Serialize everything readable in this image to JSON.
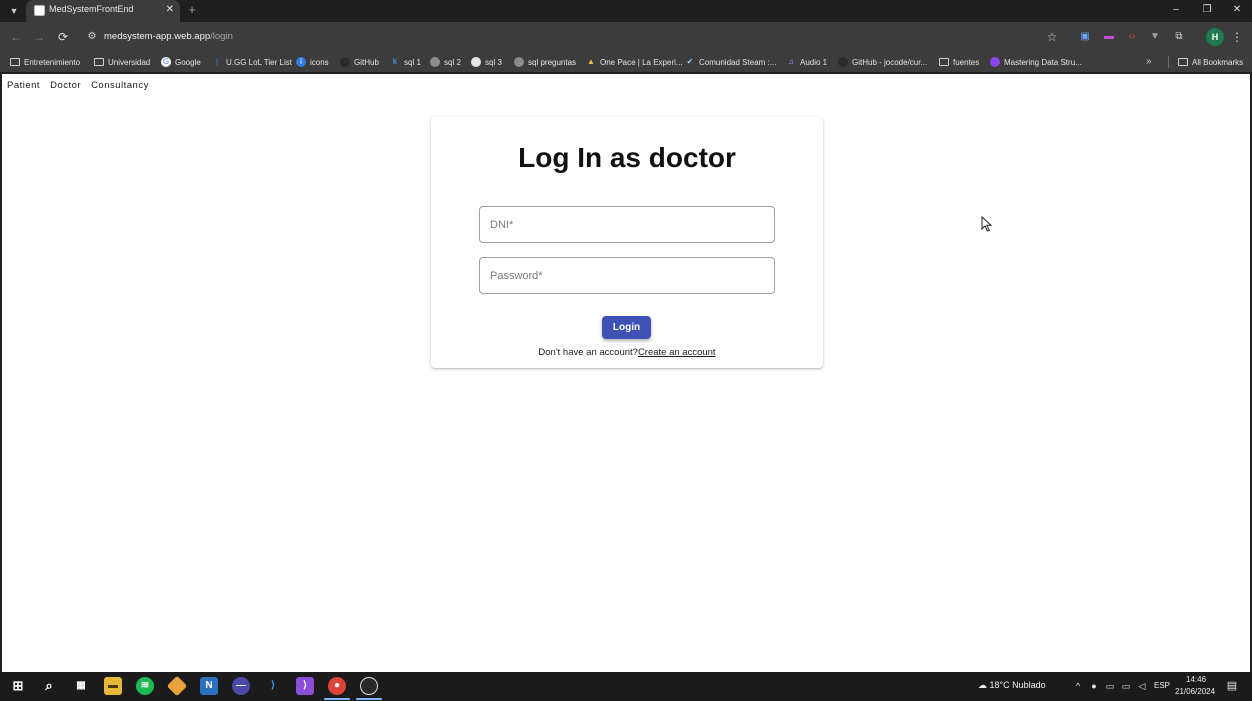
{
  "browser": {
    "tab": {
      "title": "MedSystemFrontEnd",
      "close_glyph": "✕",
      "new_tab_glyph": "+"
    },
    "window_controls": {
      "minimize": "–",
      "restore": "❐",
      "close": "✕"
    },
    "toolbar": {
      "back": "←",
      "forward": "→",
      "reload": "⟳",
      "url_host": "medsystem-app.web.app",
      "url_path": "/login",
      "star": "☆",
      "profile_initial": "H",
      "menu": "⋮"
    },
    "bookmarks": [
      {
        "label": "Entretenimiento",
        "icon": "folder-icon"
      },
      {
        "label": "Universidad",
        "icon": "folder-icon"
      },
      {
        "label": "Google",
        "icon": "google-icon"
      },
      {
        "label": "U.GG LoL Tier List",
        "icon": "ugg-icon"
      },
      {
        "label": "icons",
        "icon": "icons-site-icon"
      },
      {
        "label": "GitHub",
        "icon": "github-icon"
      },
      {
        "label": "sql 1",
        "icon": "sql-icon"
      },
      {
        "label": "sql 2",
        "icon": "globe-icon"
      },
      {
        "label": "sql 3",
        "icon": "github-icon"
      },
      {
        "label": "sql preguntas",
        "icon": "globe-icon"
      },
      {
        "label": "One Pace | La Experi...",
        "icon": "onepace-icon"
      },
      {
        "label": "Comunidad Steam :...",
        "icon": "steam-icon"
      },
      {
        "label": "Audio 1",
        "icon": "audio-icon"
      },
      {
        "label": "GitHub - jocode/cur...",
        "icon": "github-icon"
      },
      {
        "label": "fuentes",
        "icon": "folder-icon"
      },
      {
        "label": "Mastering Data Stru...",
        "icon": "course-icon"
      }
    ],
    "bookmarks_overflow": "»",
    "all_bookmarks": "All Bookmarks"
  },
  "page": {
    "nav": [
      "Patient",
      "Doctor",
      "Consultancy"
    ],
    "card": {
      "title": "Log In as doctor",
      "dni_placeholder": "DNI*",
      "dni_value": "",
      "password_placeholder": "Password*",
      "password_value": "",
      "login_label": "Login",
      "signup_prompt": "Don't have an account?",
      "signup_link": "Create an account"
    }
  },
  "taskbar": {
    "weather": "18°C  Nublado",
    "language": "ESP",
    "time": "14:46",
    "date": "21/06/2024"
  },
  "colors": {
    "primary_button": "#3f51b5",
    "page_background": "#ffffff",
    "browser_chrome": "#3c3c3c"
  }
}
